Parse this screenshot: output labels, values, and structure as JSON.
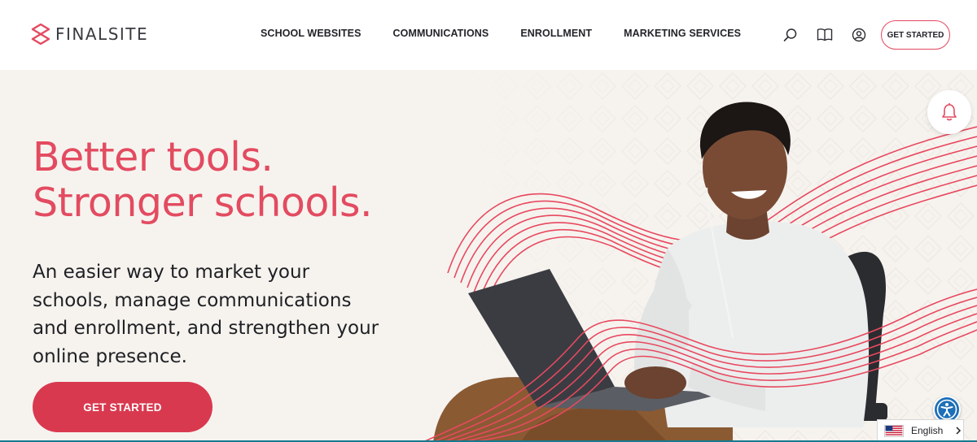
{
  "brand": {
    "name": "FINALSITE",
    "accent": "#e34b60",
    "cta_color": "#d9394f"
  },
  "nav": {
    "items": [
      {
        "label": "SCHOOL WEBSITES"
      },
      {
        "label": "COMMUNICATIONS"
      },
      {
        "label": "ENROLLMENT"
      },
      {
        "label": "MARKETING SERVICES"
      }
    ]
  },
  "header": {
    "icons": [
      "search-icon",
      "book-icon",
      "user-icon"
    ],
    "cta_label": "GET STARTED"
  },
  "hero": {
    "headline_line1": "Better tools.",
    "headline_line2": "Stronger schools.",
    "subtext": "An easier way to market your schools, manage communications and enrollment, and strengthen your online presence.",
    "cta_label": "GET STARTED"
  },
  "widgets": {
    "notification_icon": "bell-icon",
    "accessibility_icon": "accessibility-icon",
    "language_label": "English",
    "language_flag": "us-flag-icon"
  }
}
